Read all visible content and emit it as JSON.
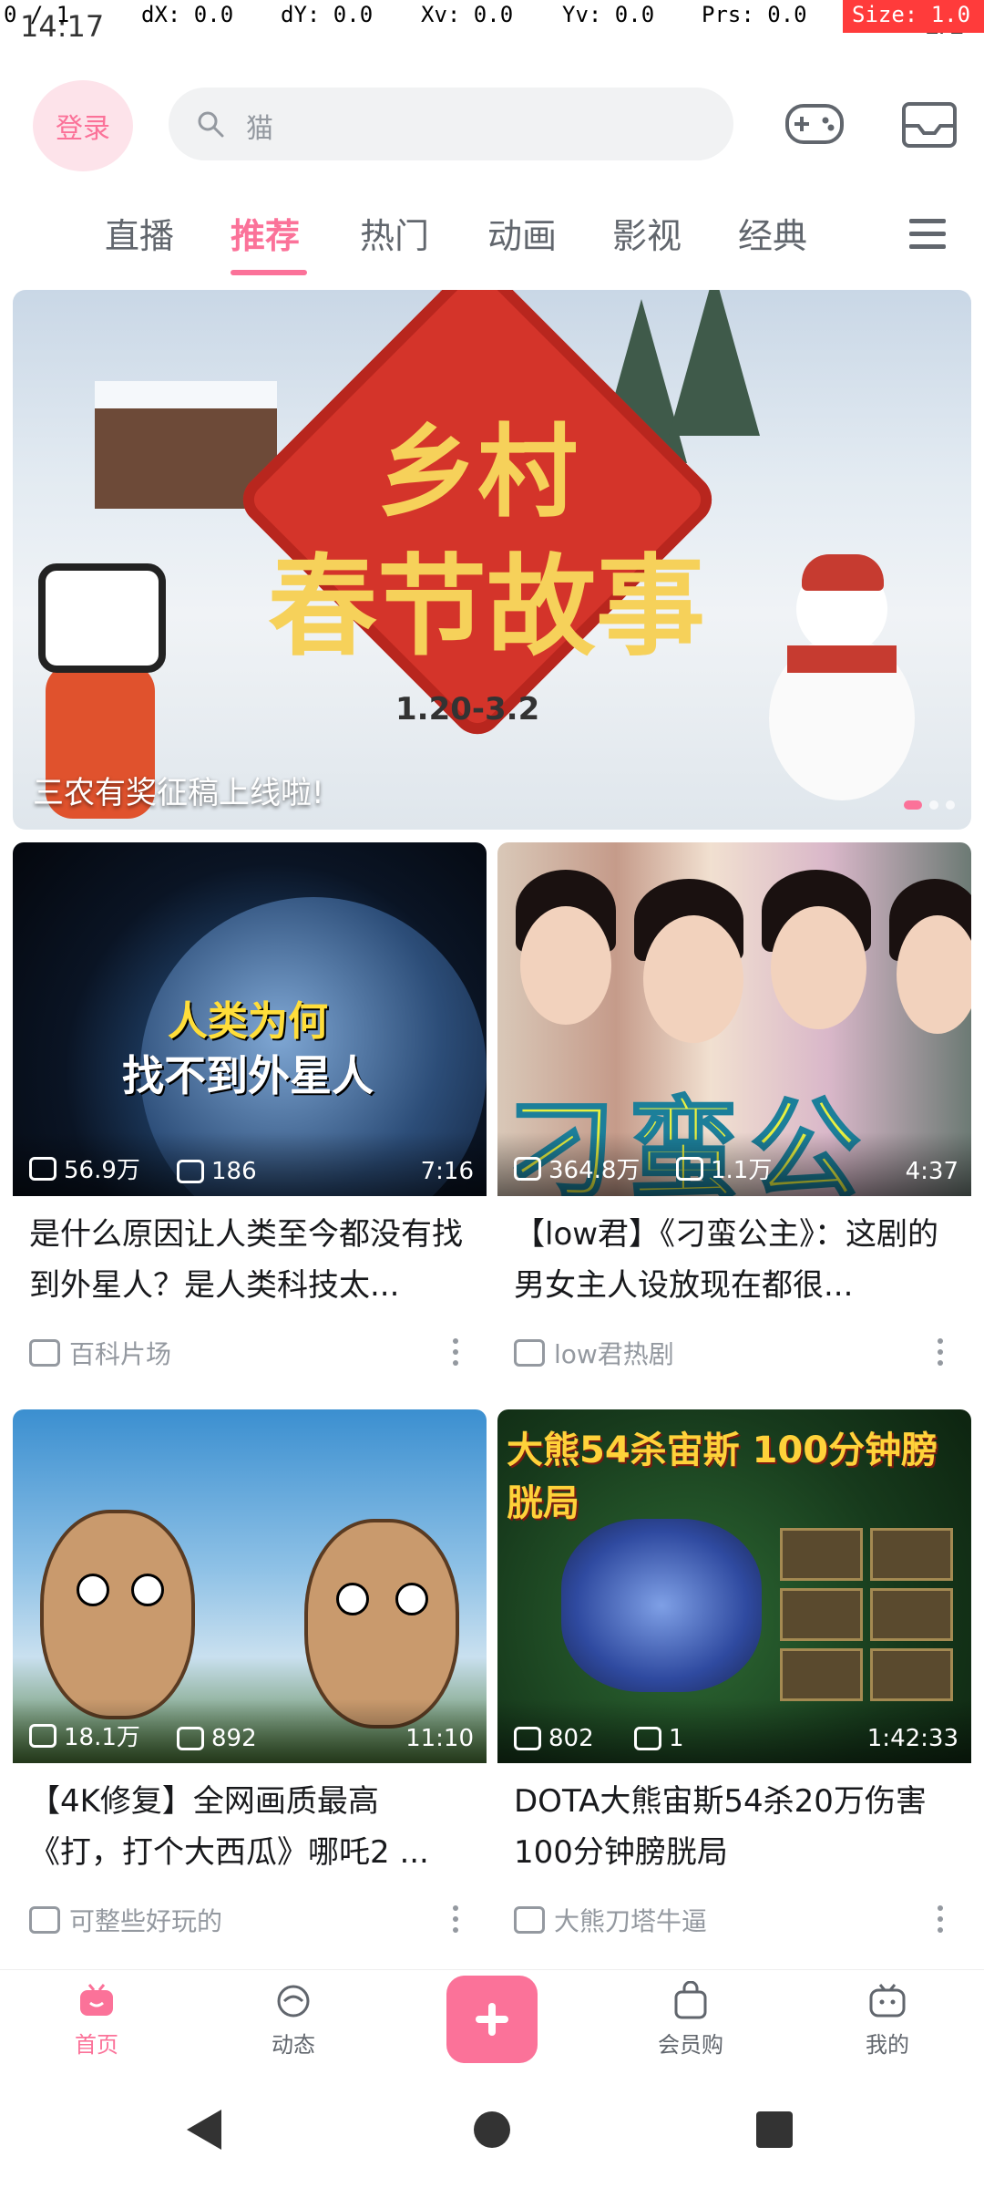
{
  "status_bar": {
    "time": "14:17",
    "network": "LTE"
  },
  "debug_overlay": {
    "pointer": "0 / 1",
    "dx": "dX: 0.0",
    "dy": "dY: 0.0",
    "xv": "Xv: 0.0",
    "yv": "Yv: 0.0",
    "prs": "Prs: 0.0",
    "size": "Size: 1.0"
  },
  "header": {
    "login_label": "登录",
    "search_placeholder": "猫",
    "game_icon": "gamepad-icon",
    "message_icon": "mail-icon"
  },
  "tabs": [
    {
      "label": "直播",
      "active": false
    },
    {
      "label": "推荐",
      "active": true
    },
    {
      "label": "热门",
      "active": false
    },
    {
      "label": "动画",
      "active": false
    },
    {
      "label": "影视",
      "active": false
    },
    {
      "label": "经典",
      "active": false
    }
  ],
  "banner": {
    "title_line1": "乡村",
    "title_line2": "春节故事",
    "date": "1.20-3.2",
    "caption": "三农有奖征稿上线啦!"
  },
  "cards": [
    {
      "thumb_text1": "人类为何",
      "thumb_text2": "找不到外星人",
      "views": "56.9万",
      "comments": "186",
      "duration": "7:16",
      "title": "是什么原因让人类至今都没有找到外星人？是人类科技太...",
      "uploader": "百科片场"
    },
    {
      "thumb_text1": "刁蛮公主",
      "views": "364.8万",
      "comments": "1.1万",
      "duration": "4:37",
      "title": "【low君】《刁蛮公主》：这剧的男女主人设放现在都很...",
      "uploader": "low君热剧"
    },
    {
      "views": "18.1万",
      "comments": "892",
      "duration": "11:10",
      "title": "【4K修复】全网画质最高《打，打个大西瓜》哪吒2 ...",
      "uploader": "可整些好玩的"
    },
    {
      "thumb_text1": "大熊54杀宙斯 100分钟膀胱局",
      "views": "802",
      "comments": "1",
      "duration": "1:42:33",
      "title": "DOTA大熊宙斯54杀20万伤害100分钟膀胱局",
      "uploader": "大熊刀塔牛逼"
    }
  ],
  "bottom_nav": [
    {
      "label": "首页",
      "icon": "home-tv-icon",
      "active": true
    },
    {
      "label": "动态",
      "icon": "feed-icon",
      "active": false
    },
    {
      "label": "",
      "icon": "publish-plus-icon",
      "active": false
    },
    {
      "label": "会员购",
      "icon": "shopping-bag-icon",
      "active": false
    },
    {
      "label": "我的",
      "icon": "profile-tv-icon",
      "active": false
    }
  ],
  "colors": {
    "brand_pink": "#fb7299",
    "text_primary": "#18191c",
    "text_secondary": "#9499a0"
  }
}
